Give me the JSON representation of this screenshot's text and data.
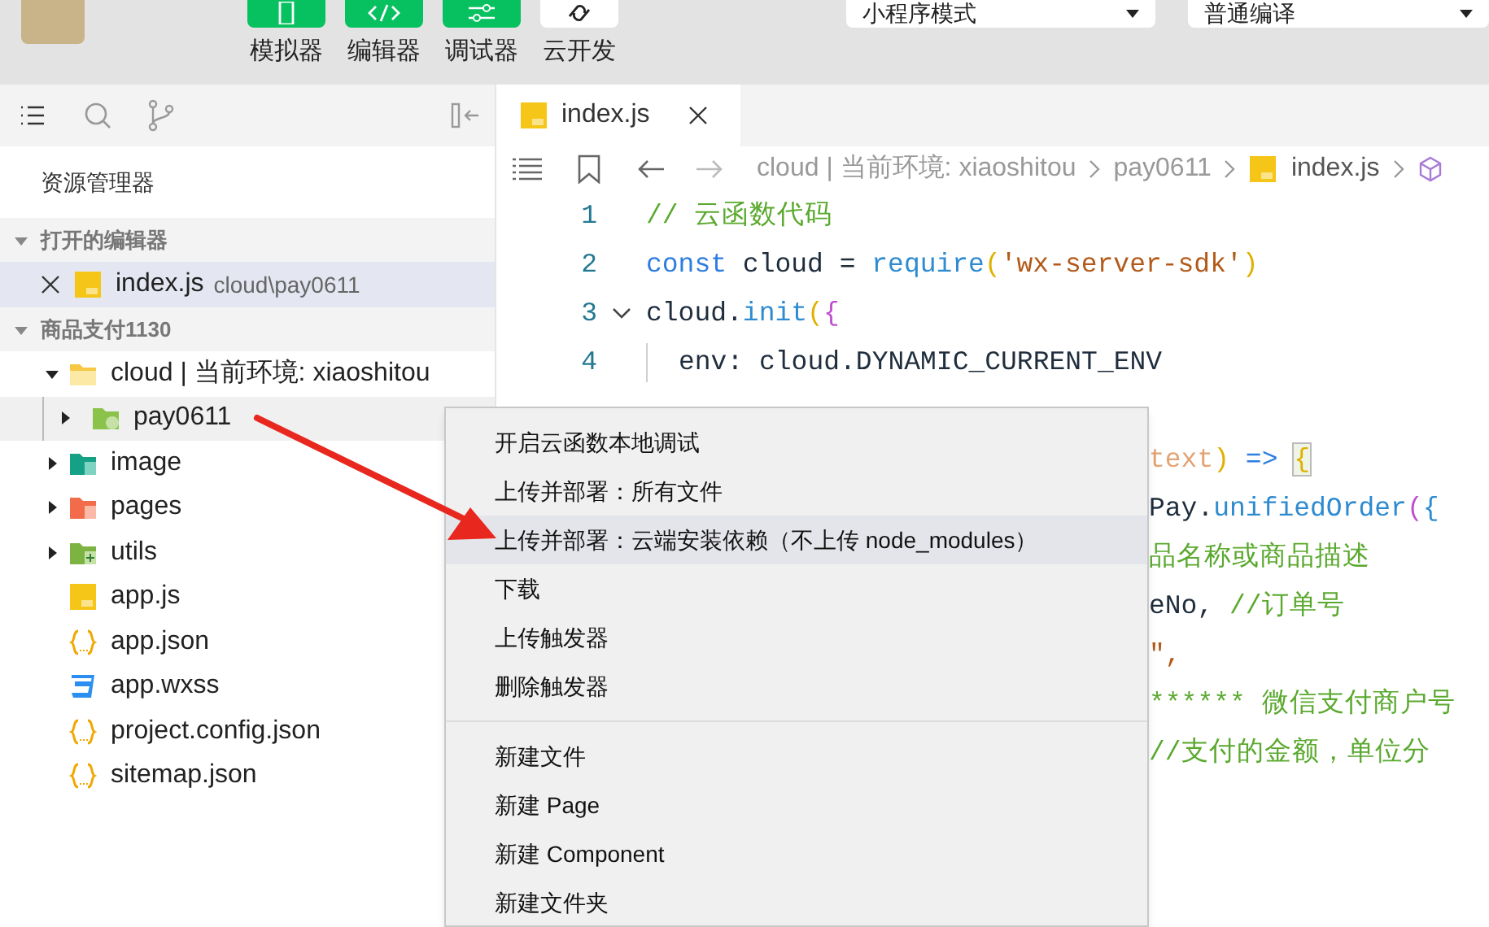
{
  "toolbar": {
    "buttons": [
      {
        "label": "模拟器",
        "kind": "phone",
        "selected": true
      },
      {
        "label": "编辑器",
        "kind": "code",
        "selected": true
      },
      {
        "label": "调试器",
        "kind": "sliders",
        "selected": true
      },
      {
        "label": "云开发",
        "kind": "link",
        "selected": false
      }
    ],
    "dropdowns": [
      {
        "value": "小程序模式"
      },
      {
        "value": "普通编译"
      }
    ]
  },
  "sidebar": {
    "title": "资源管理器",
    "open_editors": {
      "title": "打开的编辑器",
      "expanded": true,
      "items": [
        {
          "label": "index.js",
          "path": "cloud\\pay0611",
          "kind": "js",
          "selected": true
        }
      ]
    },
    "project": {
      "title": "商品支付1130",
      "expanded": true,
      "items": [
        {
          "label": "cloud | 当前环境: xiaoshitou",
          "kind": "cloud-folder",
          "expanded": true,
          "selected": false,
          "children": [
            {
              "label": "pay0611",
              "kind": "function-folder",
              "expanded": false,
              "selected": true
            }
          ]
        },
        {
          "label": "image",
          "kind": "image-folder",
          "expanded": false,
          "selected": false
        },
        {
          "label": "pages",
          "kind": "pages-folder",
          "expanded": false,
          "selected": false
        },
        {
          "label": "utils",
          "kind": "utils-folder",
          "expanded": false,
          "selected": false
        },
        {
          "label": "app.js",
          "kind": "js",
          "selected": false
        },
        {
          "label": "app.json",
          "kind": "json",
          "selected": false
        },
        {
          "label": "app.wxss",
          "kind": "wxss",
          "selected": false
        },
        {
          "label": "project.config.json",
          "kind": "json",
          "selected": false
        },
        {
          "label": "sitemap.json",
          "kind": "json",
          "selected": false
        }
      ]
    }
  },
  "editor": {
    "tab": {
      "label": "index.js",
      "selected": true
    },
    "breadcrumb": [
      {
        "label": "cloud | 当前环境: xiaoshitou",
        "kind": "folder"
      },
      {
        "label": "pay0611",
        "kind": "folder"
      },
      {
        "label": "index.js",
        "kind": "js"
      }
    ],
    "lines": [
      {
        "number": "1",
        "foldable": false,
        "indented": false,
        "segments": [
          {
            "kind": "comment",
            "text": "// 云函数代码"
          }
        ]
      },
      {
        "number": "2",
        "foldable": false,
        "indented": false,
        "segments": [
          {
            "kind": "keyword",
            "text": "const"
          },
          {
            "kind": "plain",
            "text": " cloud = "
          },
          {
            "kind": "func",
            "text": "require"
          },
          {
            "kind": "bracket",
            "text": "("
          },
          {
            "kind": "string",
            "text": "'wx-server-sdk'"
          },
          {
            "kind": "bracket",
            "text": ")"
          }
        ]
      },
      {
        "number": "3",
        "foldable": true,
        "indented": false,
        "segments": [
          {
            "kind": "plain",
            "text": "cloud."
          },
          {
            "kind": "func",
            "text": "init"
          },
          {
            "kind": "bracket",
            "text": "("
          },
          {
            "kind": "brace",
            "text": "{"
          }
        ]
      },
      {
        "number": "4",
        "foldable": false,
        "indented": true,
        "segments": [
          {
            "kind": "plain",
            "text": "env: cloud.DYNAMIC_CURRENT_ENV"
          }
        ]
      }
    ],
    "fragments": [
      {
        "segments": [
          {
            "kind": "param",
            "text": "text"
          },
          {
            "kind": "bracket",
            "text": ")"
          },
          {
            "kind": "keyword",
            "text": " => "
          },
          {
            "kind": "match",
            "text": "{"
          }
        ]
      },
      {
        "segments": [
          {
            "kind": "plain",
            "text": "Pay."
          },
          {
            "kind": "func",
            "text": "unifiedOrder"
          },
          {
            "kind": "brace",
            "text": "("
          },
          {
            "kind": "func",
            "text": "{"
          }
        ]
      },
      {
        "segments": [
          {
            "kind": "comment",
            "text": "品名称或商品描述"
          }
        ]
      },
      {
        "segments": [
          {
            "kind": "plain",
            "text": "eNo, "
          },
          {
            "kind": "comment",
            "text": "//订单号"
          }
        ]
      },
      {
        "segments": [
          {
            "kind": "string",
            "text": "\","
          }
        ]
      },
      {
        "segments": [
          {
            "kind": "comment",
            "text": "****** 微信支付商户号"
          }
        ]
      },
      {
        "segments": [
          {
            "kind": "comment",
            "text": "//支付的金额，单位分"
          }
        ]
      }
    ]
  },
  "context_menu": {
    "groups": [
      [
        {
          "label": "开启云函数本地调试",
          "selected": false
        },
        {
          "label": "上传并部署：所有文件",
          "selected": false
        },
        {
          "label": "上传并部署：云端安装依赖（不上传 node_modules）",
          "selected": true
        },
        {
          "label": "下载",
          "selected": false
        },
        {
          "label": "上传触发器",
          "selected": false
        },
        {
          "label": "删除触发器",
          "selected": false
        }
      ],
      [
        {
          "label": "新建文件",
          "selected": false
        },
        {
          "label": "新建 Page",
          "selected": false
        },
        {
          "label": "新建 Component",
          "selected": false
        },
        {
          "label": "新建文件夹",
          "selected": false
        }
      ]
    ]
  }
}
